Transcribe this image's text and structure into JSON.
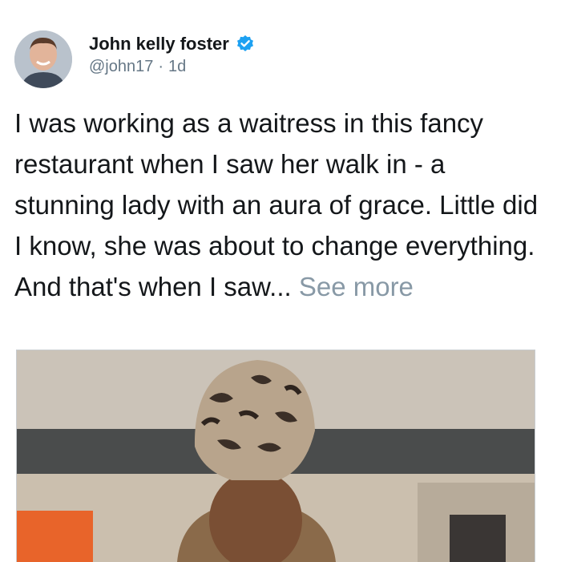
{
  "author": {
    "display_name": "John kelly foster",
    "handle": "@john17",
    "separator": "·",
    "time_ago": "1d",
    "verified": true
  },
  "tweet": {
    "text": "I was working as a waitress in this fancy restaurant when I saw her walk in - a stunning lady with an aura of grace. Little did I know, she was about to change everything. And that's when I saw...",
    "see_more_label": "See more"
  },
  "icons": {
    "avatar": "profile-photo",
    "verified": "verified-badge-icon",
    "media": "photo-woman-head-wrap"
  },
  "colors": {
    "accent": "#1da1f2",
    "text": "#14171a",
    "secondary": "#657786",
    "see_more": "#8899a6"
  }
}
